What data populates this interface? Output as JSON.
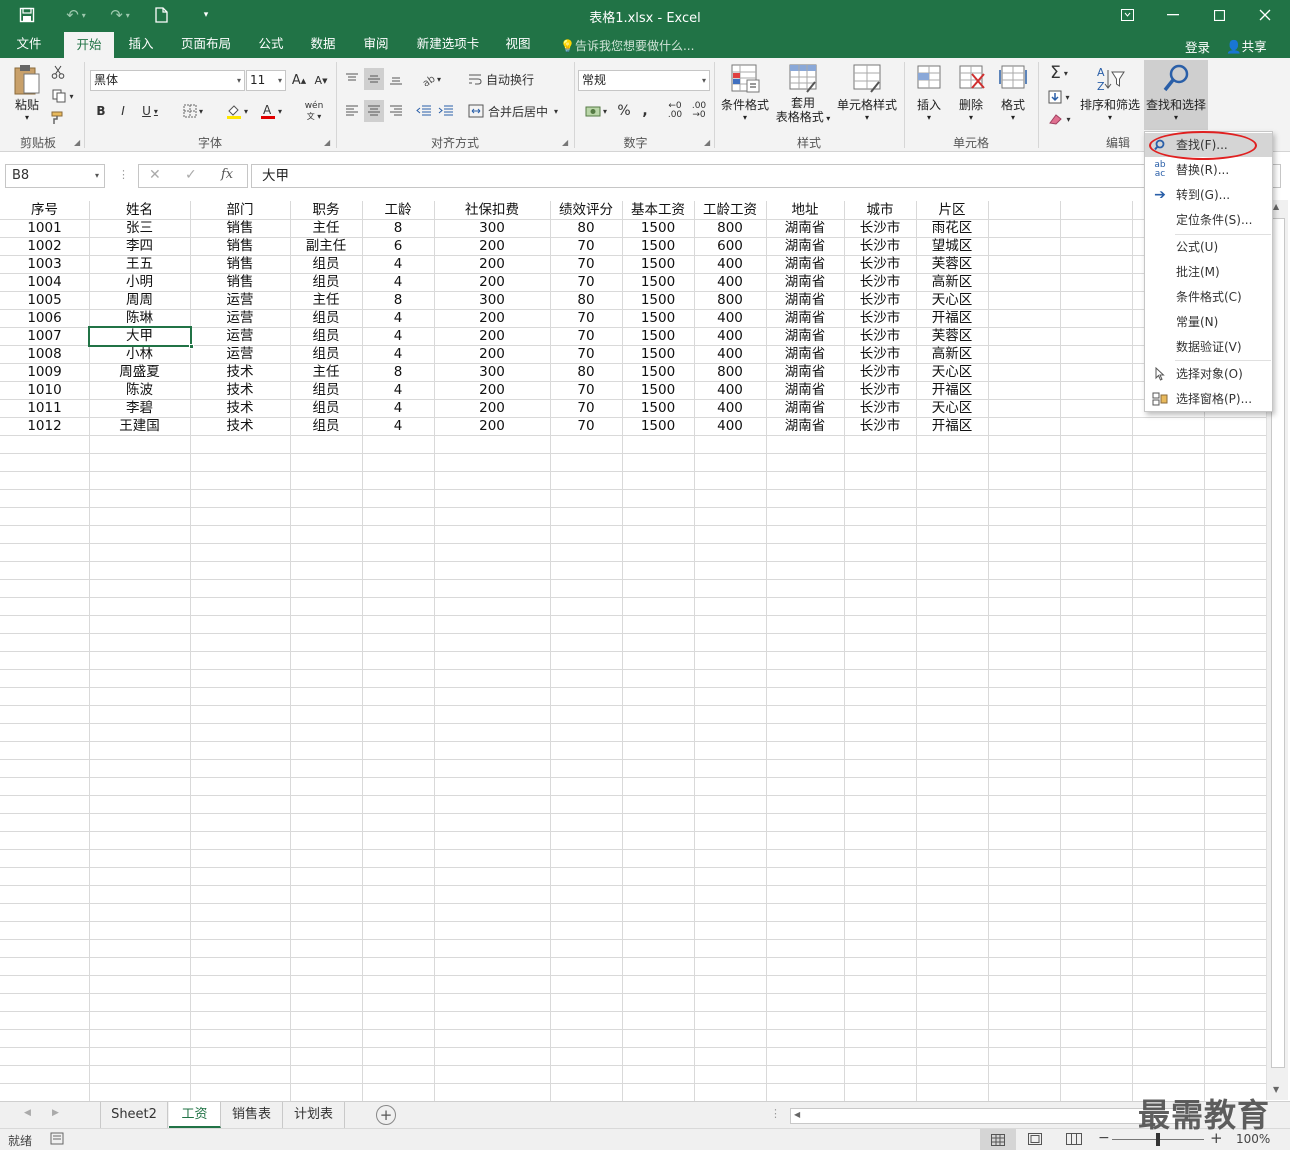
{
  "window": {
    "title": "表格1.xlsx - Excel",
    "accent": "#217346"
  },
  "quick_access": [
    "save-icon",
    "undo-icon",
    "redo-icon",
    "new-document-icon",
    "customize-icon"
  ],
  "tabs": [
    {
      "label": "文件"
    },
    {
      "label": "开始"
    },
    {
      "label": "插入"
    },
    {
      "label": "页面布局"
    },
    {
      "label": "公式"
    },
    {
      "label": "数据"
    },
    {
      "label": "审阅"
    },
    {
      "label": "新建选项卡"
    },
    {
      "label": "视图"
    }
  ],
  "active_tab": "开始",
  "tell_me": "告诉我您想要做什么...",
  "login": "登录",
  "share": "共享",
  "ribbon": {
    "clipboard": {
      "group": "剪贴板",
      "paste": "粘贴"
    },
    "font": {
      "group": "字体",
      "font_name": "黑体",
      "font_size": "11",
      "bold": "B",
      "italic": "I",
      "underline": "U",
      "grow": "A",
      "shrink": "A",
      "phonetic": "wén"
    },
    "alignment": {
      "group": "对齐方式",
      "wrap": "自动换行",
      "merge": "合并后居中"
    },
    "number": {
      "group": "数字",
      "format": "常规",
      "percent": "%",
      "comma": ",",
      "inc_decimal": ".00",
      "dec_decimal": ".00"
    },
    "styles": {
      "group": "样式",
      "conditional": "条件格式",
      "table_line1": "套用",
      "table_line2": "表格格式",
      "cell_styles": "单元格样式"
    },
    "cells": {
      "group": "单元格",
      "insert": "插入",
      "delete": "删除",
      "format": "格式"
    },
    "editing": {
      "group": "编辑",
      "sort": "排序和筛选",
      "find": "查找和选择"
    }
  },
  "formula_bar": {
    "name_box": "B8",
    "fx": "fx",
    "content": "大甲"
  },
  "sheet": {
    "headers": [
      "序号",
      "姓名",
      "部门",
      "职务",
      "工龄",
      "社保扣费",
      "绩效评分",
      "基本工资",
      "工龄工资",
      "地址",
      "城市",
      "片区"
    ],
    "rows": [
      [
        "1001",
        "张三",
        "销售",
        "主任",
        "8",
        "300",
        "80",
        "1500",
        "800",
        "湖南省",
        "长沙市",
        "雨花区"
      ],
      [
        "1002",
        "李四",
        "销售",
        "副主任",
        "6",
        "200",
        "70",
        "1500",
        "600",
        "湖南省",
        "长沙市",
        "望城区"
      ],
      [
        "1003",
        "王五",
        "销售",
        "组员",
        "4",
        "200",
        "70",
        "1500",
        "400",
        "湖南省",
        "长沙市",
        "芙蓉区"
      ],
      [
        "1004",
        "小明",
        "销售",
        "组员",
        "4",
        "200",
        "70",
        "1500",
        "400",
        "湖南省",
        "长沙市",
        "高新区"
      ],
      [
        "1005",
        "周周",
        "运营",
        "主任",
        "8",
        "300",
        "80",
        "1500",
        "800",
        "湖南省",
        "长沙市",
        "天心区"
      ],
      [
        "1006",
        "陈琳",
        "运营",
        "组员",
        "4",
        "200",
        "70",
        "1500",
        "400",
        "湖南省",
        "长沙市",
        "开福区"
      ],
      [
        "1007",
        "大甲",
        "运营",
        "组员",
        "4",
        "200",
        "70",
        "1500",
        "400",
        "湖南省",
        "长沙市",
        "芙蓉区"
      ],
      [
        "1008",
        "小林",
        "运营",
        "组员",
        "4",
        "200",
        "70",
        "1500",
        "400",
        "湖南省",
        "长沙市",
        "高新区"
      ],
      [
        "1009",
        "周盛夏",
        "技术",
        "主任",
        "8",
        "300",
        "80",
        "1500",
        "800",
        "湖南省",
        "长沙市",
        "天心区"
      ],
      [
        "1010",
        "陈波",
        "技术",
        "组员",
        "4",
        "200",
        "70",
        "1500",
        "400",
        "湖南省",
        "长沙市",
        "开福区"
      ],
      [
        "1011",
        "李碧",
        "技术",
        "组员",
        "4",
        "200",
        "70",
        "1500",
        "400",
        "湖南省",
        "长沙市",
        "天心区"
      ],
      [
        "1012",
        "王建国",
        "技术",
        "组员",
        "4",
        "200",
        "70",
        "1500",
        "400",
        "湖南省",
        "长沙市",
        "开福区"
      ]
    ],
    "active_cell": "B8"
  },
  "sheet_tabs": [
    {
      "label": "Sheet2"
    },
    {
      "label": "工资"
    },
    {
      "label": "销售表"
    },
    {
      "label": "计划表"
    }
  ],
  "active_sheet": "工资",
  "status": {
    "ready": "就绪",
    "zoom": "100%"
  },
  "find_menu": {
    "items": [
      {
        "label": "查找(F)...",
        "icon": "search-icon"
      },
      {
        "label": "替换(R)...",
        "icon": "replace-icon"
      },
      {
        "label": "转到(G)...",
        "icon": "arrow-right-icon"
      },
      {
        "label": "定位条件(S)...",
        "icon": ""
      },
      {
        "label": "公式(U)",
        "icon": ""
      },
      {
        "label": "批注(M)",
        "icon": ""
      },
      {
        "label": "条件格式(C)",
        "icon": ""
      },
      {
        "label": "常量(N)",
        "icon": ""
      },
      {
        "label": "数据验证(V)",
        "icon": ""
      },
      {
        "label": "选择对象(O)",
        "icon": "pointer-icon"
      },
      {
        "label": "选择窗格(P)...",
        "icon": "selection-pane-icon"
      }
    ]
  },
  "watermark": "最需教育"
}
